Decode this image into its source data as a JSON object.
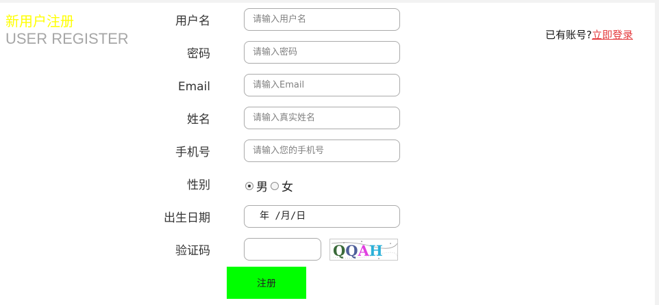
{
  "heading": {
    "title_cn": "新用户注册",
    "title_en": "USER REGISTER"
  },
  "form": {
    "username": {
      "label": "用户名",
      "placeholder": "请输入用户名"
    },
    "password": {
      "label": "密码",
      "placeholder": "请输入密码"
    },
    "email": {
      "label": "Email",
      "placeholder": "请输入Email"
    },
    "name": {
      "label": "姓名",
      "placeholder": "请输入真实姓名"
    },
    "phone": {
      "label": "手机号",
      "placeholder": "请输入您的手机号"
    },
    "gender": {
      "label": "性别",
      "male": "男",
      "female": "女",
      "selected": "男"
    },
    "birthday": {
      "label": "出生日期",
      "value": "年 /月/日"
    },
    "captcha": {
      "label": "验证码",
      "image_text": "QQAH"
    },
    "submit_label": "注册"
  },
  "login": {
    "prompt": "已有账号?",
    "link": "立即登录"
  },
  "colors": {
    "title_cn": "#ffff00",
    "title_en": "#a6a6a6",
    "submit_bg": "#00ff00",
    "login_link": "#e4393c",
    "page_bg": "#f2f2f2"
  }
}
